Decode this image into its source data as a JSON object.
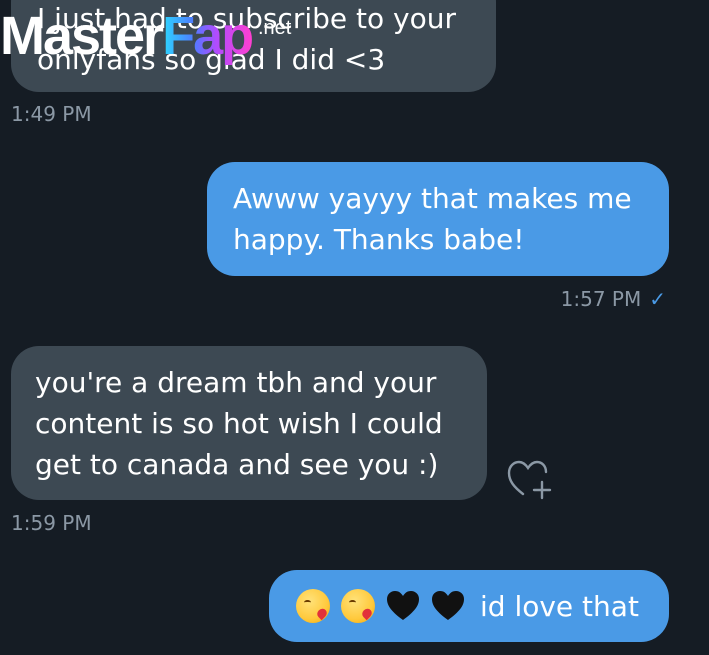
{
  "messages": [
    {
      "id": "m1",
      "direction": "incoming",
      "text": "I just had to subscribe to your\nonlyfans so glad I did <3",
      "time": "1:49 PM"
    },
    {
      "id": "m2",
      "direction": "outgoing",
      "text": "Awww yayyy that makes me\nhappy. Thanks babe!",
      "time": "1:57 PM",
      "read_receipt": "check-icon"
    },
    {
      "id": "m3",
      "direction": "incoming",
      "text": "you're a dream tbh and your\ncontent is so hot wish I could\nget to canada and see you :)",
      "time": "1:59 PM"
    },
    {
      "id": "m4",
      "direction": "outgoing",
      "emojis": [
        "kissing-heart-emoji",
        "kissing-heart-emoji",
        "black-heart-emoji",
        "black-heart-emoji"
      ],
      "text": "id love that"
    }
  ],
  "watermark": {
    "part1": "Master",
    "part2": "Fap",
    "suffix": ".net"
  },
  "icons": {
    "react": "heart-plus-icon",
    "read": "checkmark-icon"
  },
  "colors": {
    "background": "#151c24",
    "incoming_bubble": "#3d4953",
    "outgoing_bubble": "#4a9ae6",
    "timestamp": "#8b98a5"
  }
}
